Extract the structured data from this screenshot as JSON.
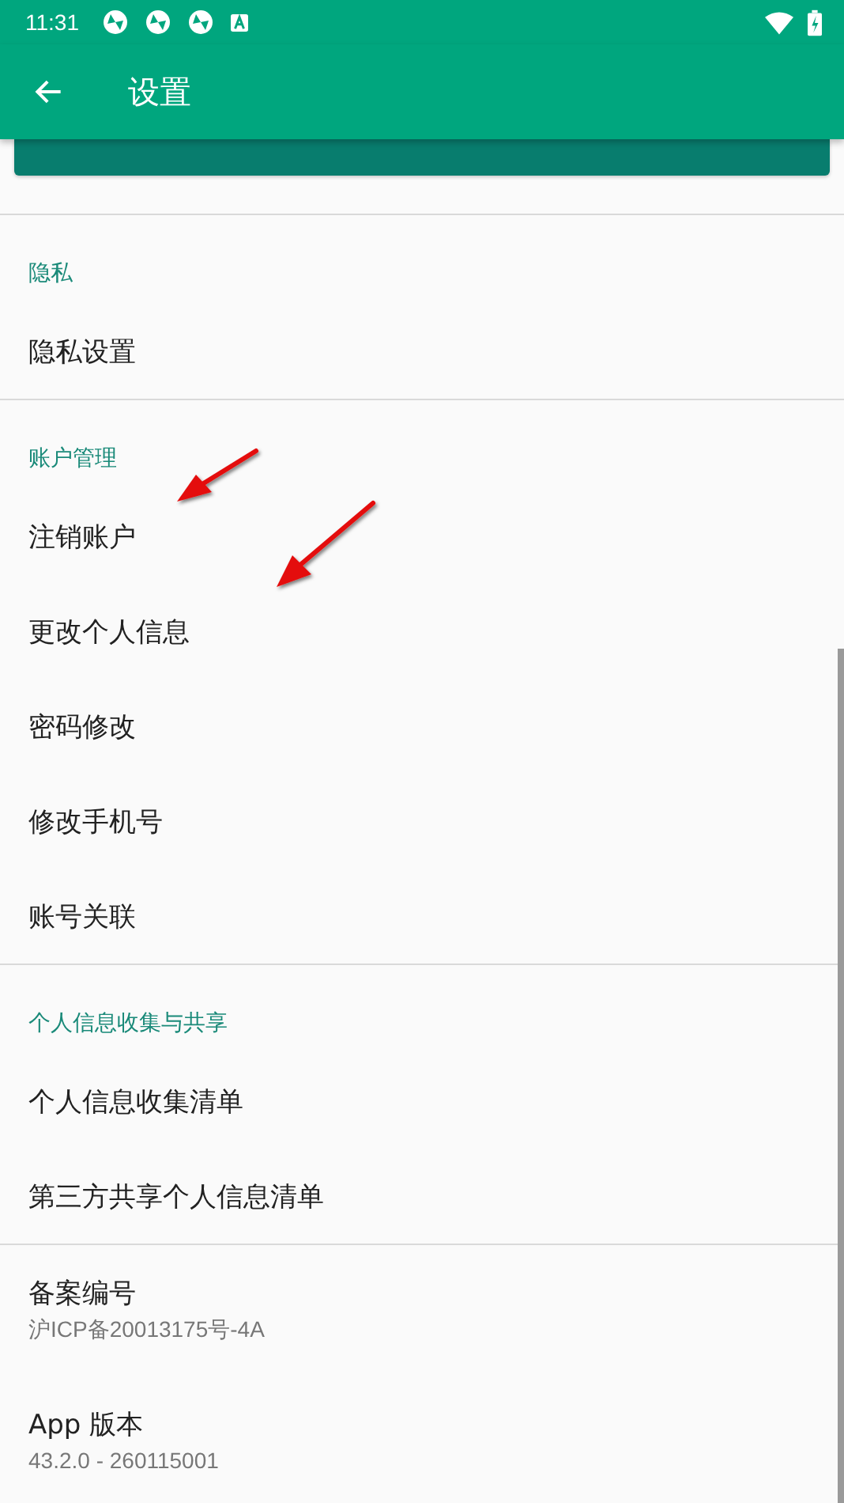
{
  "status_bar": {
    "time": "11:31"
  },
  "toolbar": {
    "title": "设置"
  },
  "sections": [
    {
      "items": [
        {
          "kind": "button"
        }
      ]
    },
    {
      "header": "隐私",
      "items": [
        {
          "kind": "preference",
          "title": "隐私设置"
        }
      ]
    },
    {
      "header": "账户管理",
      "items": [
        {
          "kind": "preference",
          "title": "注销账户"
        },
        {
          "kind": "preference",
          "title": "更改个人信息"
        },
        {
          "kind": "preference",
          "title": "密码修改"
        },
        {
          "kind": "preference",
          "title": "修改手机号"
        },
        {
          "kind": "preference",
          "title": "账号关联"
        }
      ]
    },
    {
      "header": "个人信息收集与共享",
      "items": [
        {
          "kind": "preference",
          "title": "个人信息收集清单"
        },
        {
          "kind": "preference",
          "title": "第三方共享个人信息清单"
        }
      ]
    },
    {
      "items": [
        {
          "kind": "preference",
          "title": "备案编号",
          "summary": "沪ICP备20013175号-4A"
        },
        {
          "kind": "preference",
          "title": "App 版本",
          "summary": "43.2.0 - 260115001"
        }
      ]
    }
  ]
}
